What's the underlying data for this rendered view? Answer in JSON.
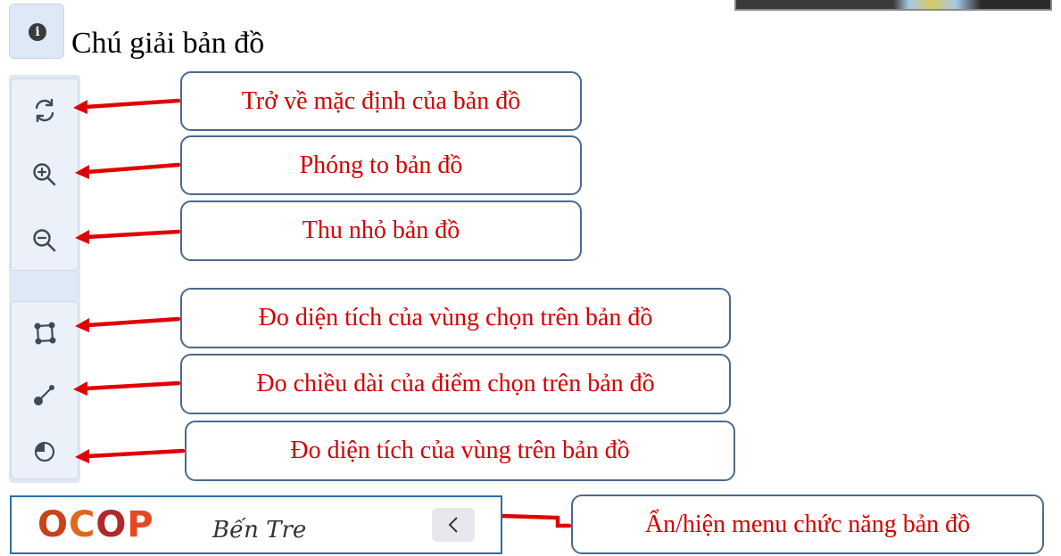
{
  "legend": {
    "info_icon": "info-circle",
    "info_glyph": "i",
    "title": "Chú giải bản đồ"
  },
  "toolbar": {
    "tools": [
      {
        "icon": "refresh-icon",
        "label": "Trở về mặc định của bản đồ"
      },
      {
        "icon": "zoom-in-icon",
        "label": "Phóng to bản đồ"
      },
      {
        "icon": "zoom-out-icon",
        "label": "Thu nhỏ bản đồ"
      },
      {
        "icon": "polygon-select-icon",
        "label": "Đo diện tích của vùng chọn trên bản đồ"
      },
      {
        "icon": "line-measure-icon",
        "label": "Đo chiều dài của điểm chọn trên bản đồ"
      },
      {
        "icon": "circle-area-icon",
        "label": "Đo diện tích của vùng trên bản đồ"
      }
    ]
  },
  "footer": {
    "logo_ocop_chars": [
      "O",
      "C",
      "O",
      "P"
    ],
    "logo_place": "Bến Tre",
    "toggle_icon": "chevron-left-icon",
    "toggle_label": "Ẩn/hiện menu chức năng bản đồ"
  },
  "colors": {
    "annotation_text": "#d40000",
    "arrow": "#e00000",
    "callout_border": "#4a6a8c",
    "toolbar_bg": "#dfe8f6",
    "logo_o1": "#c8421a",
    "logo_c": "#e0671c",
    "logo_o2": "#b0282a",
    "logo_p": "#e34a22"
  }
}
